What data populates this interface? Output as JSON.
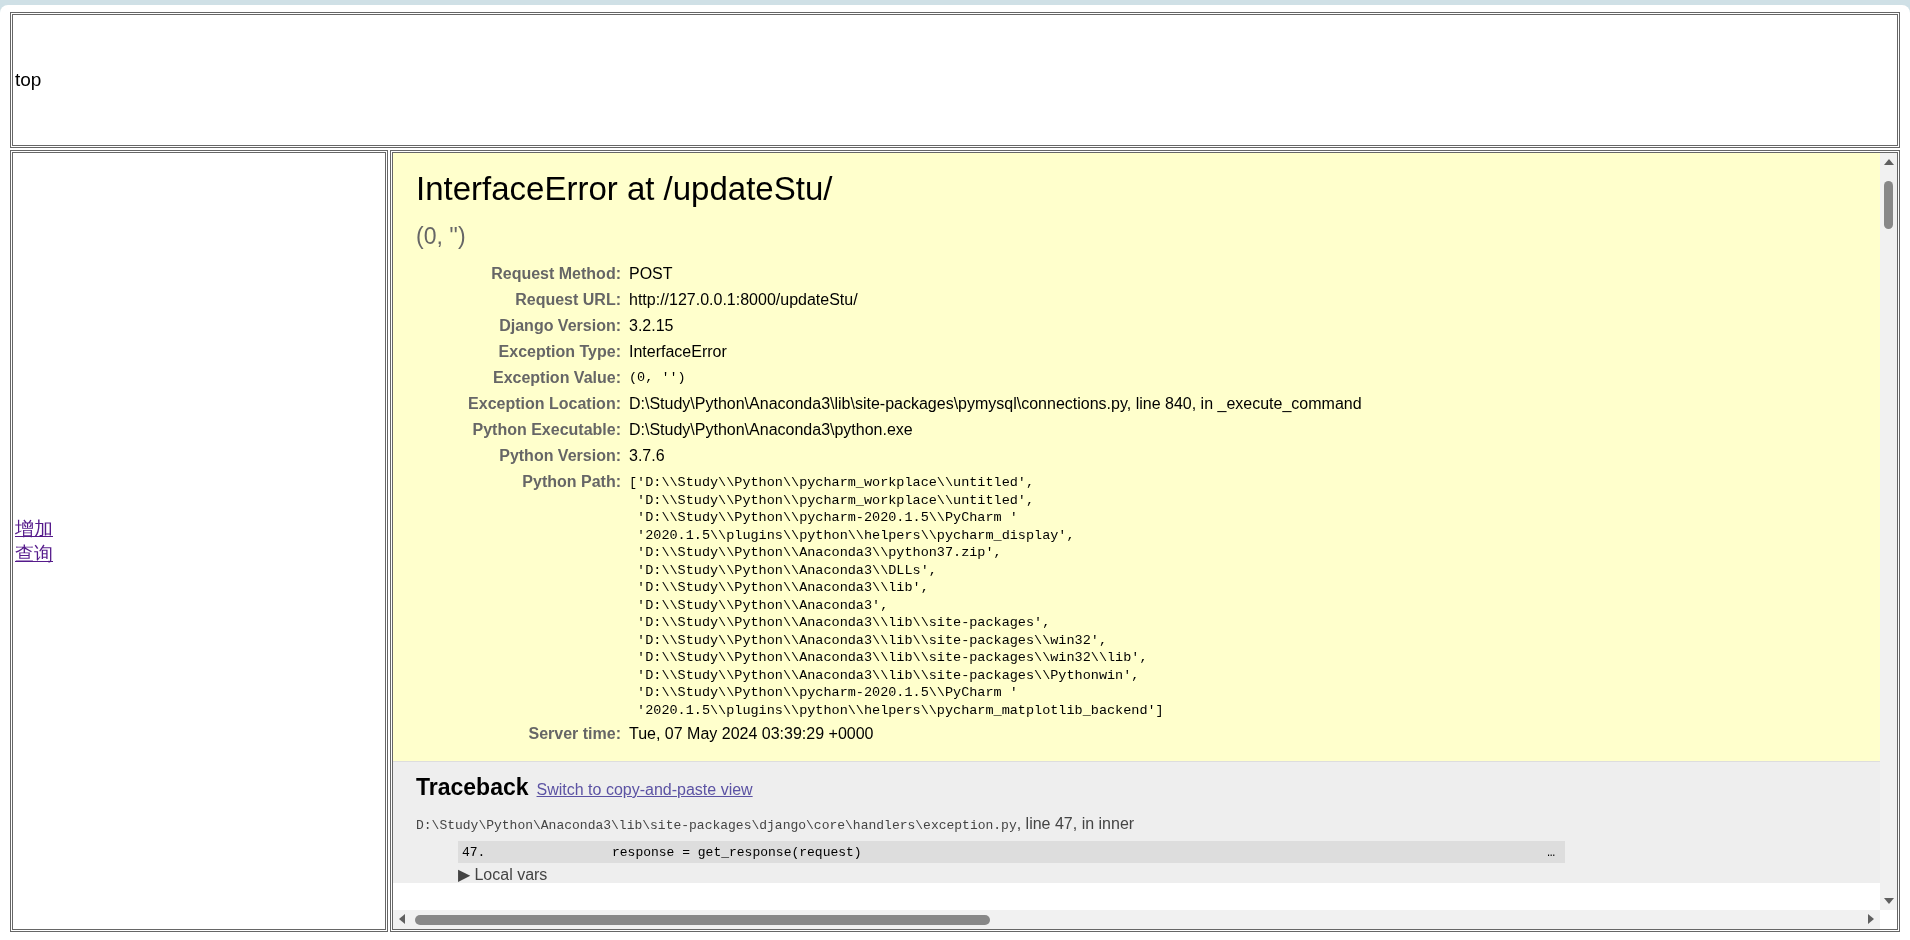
{
  "top_frame": {
    "text": "top"
  },
  "nav_links": [
    "增加",
    "查询"
  ],
  "summary": {
    "title": "InterfaceError at /updateStu/",
    "subtitle": "(0, '')",
    "meta": [
      {
        "kind": "text",
        "label": "Request Method:",
        "value": "POST"
      },
      {
        "kind": "text",
        "label": "Request URL:",
        "value": "http://127.0.0.1:8000/updateStu/"
      },
      {
        "kind": "text",
        "label": "Django Version:",
        "value": "3.2.15"
      },
      {
        "kind": "text",
        "label": "Exception Type:",
        "value": "InterfaceError"
      },
      {
        "kind": "code",
        "label": "Exception Value:",
        "value": "(0, '')"
      },
      {
        "kind": "text",
        "label": "Exception Location:",
        "value": "D:\\Study\\Python\\Anaconda3\\lib\\site-packages\\pymysql\\connections.py, line 840, in _execute_command"
      },
      {
        "kind": "text",
        "label": "Python Executable:",
        "value": "D:\\Study\\Python\\Anaconda3\\python.exe"
      },
      {
        "kind": "text",
        "label": "Python Version:",
        "value": "3.7.6"
      },
      {
        "kind": "lines",
        "label": "Python Path:",
        "lines": [
          "['D:\\\\Study\\\\Python\\\\pycharm_workplace\\\\untitled',",
          " 'D:\\\\Study\\\\Python\\\\pycharm_workplace\\\\untitled',",
          " 'D:\\\\Study\\\\Python\\\\pycharm-2020.1.5\\\\PyCharm '",
          " '2020.1.5\\\\plugins\\\\python\\\\helpers\\\\pycharm_display',",
          " 'D:\\\\Study\\\\Python\\\\Anaconda3\\\\python37.zip',",
          " 'D:\\\\Study\\\\Python\\\\Anaconda3\\\\DLLs',",
          " 'D:\\\\Study\\\\Python\\\\Anaconda3\\\\lib',",
          " 'D:\\\\Study\\\\Python\\\\Anaconda3',",
          " 'D:\\\\Study\\\\Python\\\\Anaconda3\\\\lib\\\\site-packages',",
          " 'D:\\\\Study\\\\Python\\\\Anaconda3\\\\lib\\\\site-packages\\\\win32',",
          " 'D:\\\\Study\\\\Python\\\\Anaconda3\\\\lib\\\\site-packages\\\\win32\\\\lib',",
          " 'D:\\\\Study\\\\Python\\\\Anaconda3\\\\lib\\\\site-packages\\\\Pythonwin',",
          " 'D:\\\\Study\\\\Python\\\\pycharm-2020.1.5\\\\PyCharm '",
          " '2020.1.5\\\\plugins\\\\python\\\\helpers\\\\pycharm_matplotlib_backend']"
        ]
      },
      {
        "kind": "text",
        "label": "Server time:",
        "value": "Tue, 07 May 2024 03:39:29 +0000"
      }
    ]
  },
  "traceback": {
    "title": "Traceback",
    "link": "Switch to copy-and-paste view",
    "frames": [
      {
        "file": "D:\\Study\\Python\\Anaconda3\\lib\\site-packages\\django\\core\\handlers\\exception.py",
        "location": ", line 47, in inner",
        "line_number": "47.",
        "code": "response = get_response(request)",
        "more": "…",
        "local_vars": "▶ Local vars"
      }
    ]
  }
}
